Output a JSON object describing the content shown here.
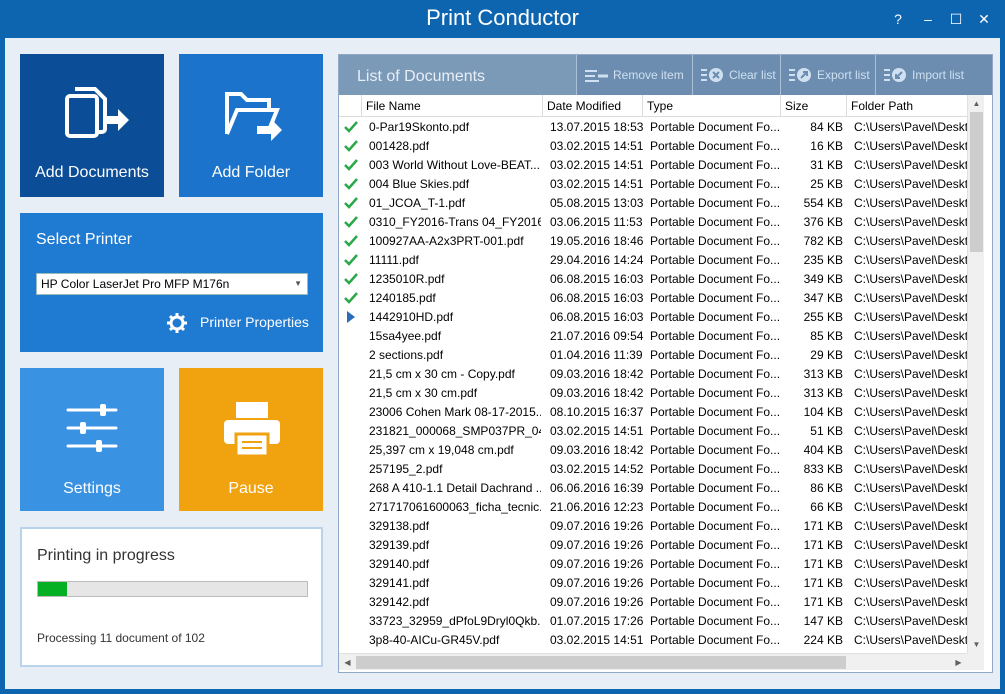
{
  "window": {
    "title": "Print Conductor",
    "help": "?",
    "minimize": "–",
    "maximize": "☐",
    "close": "✕"
  },
  "tiles": {
    "add_documents": "Add Documents",
    "add_folder": "Add Folder",
    "select_printer": "Select Printer",
    "printer_value": "HP Color LaserJet Pro MFP M176n",
    "printer_properties": "Printer Properties",
    "settings": "Settings",
    "pause": "Pause"
  },
  "progress": {
    "title": "Printing in progress",
    "status": "Processing 11 document of 102",
    "fraction": 0.108
  },
  "documents": {
    "title": "List of Documents",
    "toolbar": {
      "remove": "Remove item",
      "clear": "Clear list",
      "export": "Export list",
      "import": "Import list"
    },
    "columns": [
      "File Name",
      "Date Modified",
      "Type",
      "Size",
      "Folder Path"
    ],
    "rows": [
      {
        "status": "done",
        "name": "0-Par19Skonto.pdf",
        "date": "13.07.2015 18:53",
        "type": "Portable Document Fo...",
        "size": "84 KB",
        "path": "C:\\Users\\Pavel\\Deskt"
      },
      {
        "status": "done",
        "name": "001428.pdf",
        "date": "03.02.2015 14:51",
        "type": "Portable Document Fo...",
        "size": "16 KB",
        "path": "C:\\Users\\Pavel\\Deskt"
      },
      {
        "status": "done",
        "name": "003 World Without Love-BEAT...",
        "date": "03.02.2015 14:51",
        "type": "Portable Document Fo...",
        "size": "31 KB",
        "path": "C:\\Users\\Pavel\\Deskt"
      },
      {
        "status": "done",
        "name": "004 Blue Skies.pdf",
        "date": "03.02.2015 14:51",
        "type": "Portable Document Fo...",
        "size": "25 KB",
        "path": "C:\\Users\\Pavel\\Deskt"
      },
      {
        "status": "done",
        "name": "01_JCOA_T-1.pdf",
        "date": "05.08.2015 13:03",
        "type": "Portable Document Fo...",
        "size": "554 KB",
        "path": "C:\\Users\\Pavel\\Deskt"
      },
      {
        "status": "done",
        "name": "0310_FY2016-Trans 04_FY2016...",
        "date": "03.06.2015 11:53",
        "type": "Portable Document Fo...",
        "size": "376 KB",
        "path": "C:\\Users\\Pavel\\Deskt"
      },
      {
        "status": "done",
        "name": "100927AA-A2x3PRT-001.pdf",
        "date": "19.05.2016 18:46",
        "type": "Portable Document Fo...",
        "size": "782 KB",
        "path": "C:\\Users\\Pavel\\Deskt"
      },
      {
        "status": "done",
        "name": "11111.pdf",
        "date": "29.04.2016 14:24",
        "type": "Portable Document Fo...",
        "size": "235 KB",
        "path": "C:\\Users\\Pavel\\Deskt"
      },
      {
        "status": "done",
        "name": "1235010R.pdf",
        "date": "06.08.2015 16:03",
        "type": "Portable Document Fo...",
        "size": "349 KB",
        "path": "C:\\Users\\Pavel\\Deskt"
      },
      {
        "status": "done",
        "name": "1240185.pdf",
        "date": "06.08.2015 16:03",
        "type": "Portable Document Fo...",
        "size": "347 KB",
        "path": "C:\\Users\\Pavel\\Deskt"
      },
      {
        "status": "current",
        "name": "1442910HD.pdf",
        "date": "06.08.2015 16:03",
        "type": "Portable Document Fo...",
        "size": "255 KB",
        "path": "C:\\Users\\Pavel\\Deskt"
      },
      {
        "status": "",
        "name": "15sa4yee.pdf",
        "date": "21.07.2016 09:54",
        "type": "Portable Document Fo...",
        "size": "85 KB",
        "path": "C:\\Users\\Pavel\\Deskt"
      },
      {
        "status": "",
        "name": "2 sections.pdf",
        "date": "01.04.2016 11:39",
        "type": "Portable Document Fo...",
        "size": "29 KB",
        "path": "C:\\Users\\Pavel\\Deskt"
      },
      {
        "status": "",
        "name": "21,5 cm x 30 cm - Copy.pdf",
        "date": "09.03.2016 18:42",
        "type": "Portable Document Fo...",
        "size": "313 KB",
        "path": "C:\\Users\\Pavel\\Deskt"
      },
      {
        "status": "",
        "name": "21,5 cm x 30 cm.pdf",
        "date": "09.03.2016 18:42",
        "type": "Portable Document Fo...",
        "size": "313 KB",
        "path": "C:\\Users\\Pavel\\Deskt"
      },
      {
        "status": "",
        "name": "23006 Cohen Mark 08-17-2015...",
        "date": "08.10.2015 16:37",
        "type": "Portable Document Fo...",
        "size": "104 KB",
        "path": "C:\\Users\\Pavel\\Deskt"
      },
      {
        "status": "",
        "name": "231821_000068_SMP037PR_04...",
        "date": "03.02.2015 14:51",
        "type": "Portable Document Fo...",
        "size": "51 KB",
        "path": "C:\\Users\\Pavel\\Deskt"
      },
      {
        "status": "",
        "name": "25,397 cm x 19,048 cm.pdf",
        "date": "09.03.2016 18:42",
        "type": "Portable Document Fo...",
        "size": "404 KB",
        "path": "C:\\Users\\Pavel\\Deskt"
      },
      {
        "status": "",
        "name": "257195_2.pdf",
        "date": "03.02.2015 14:52",
        "type": "Portable Document Fo...",
        "size": "833 KB",
        "path": "C:\\Users\\Pavel\\Deskt"
      },
      {
        "status": "",
        "name": "268 A 410-1.1 Detail Dachrand ...",
        "date": "06.06.2016 16:39",
        "type": "Portable Document Fo...",
        "size": "86 KB",
        "path": "C:\\Users\\Pavel\\Deskt"
      },
      {
        "status": "",
        "name": "271717061600063_ficha_tecnic...",
        "date": "21.06.2016 12:23",
        "type": "Portable Document Fo...",
        "size": "66 KB",
        "path": "C:\\Users\\Pavel\\Deskt"
      },
      {
        "status": "",
        "name": "329138.pdf",
        "date": "09.07.2016 19:26",
        "type": "Portable Document Fo...",
        "size": "171 KB",
        "path": "C:\\Users\\Pavel\\Deskt"
      },
      {
        "status": "",
        "name": "329139.pdf",
        "date": "09.07.2016 19:26",
        "type": "Portable Document Fo...",
        "size": "171 KB",
        "path": "C:\\Users\\Pavel\\Deskt"
      },
      {
        "status": "",
        "name": "329140.pdf",
        "date": "09.07.2016 19:26",
        "type": "Portable Document Fo...",
        "size": "171 KB",
        "path": "C:\\Users\\Pavel\\Deskt"
      },
      {
        "status": "",
        "name": "329141.pdf",
        "date": "09.07.2016 19:26",
        "type": "Portable Document Fo...",
        "size": "171 KB",
        "path": "C:\\Users\\Pavel\\Deskt"
      },
      {
        "status": "",
        "name": "329142.pdf",
        "date": "09.07.2016 19:26",
        "type": "Portable Document Fo...",
        "size": "171 KB",
        "path": "C:\\Users\\Pavel\\Deskt"
      },
      {
        "status": "",
        "name": "33723_32959_dPfoL9Dryl0Qkb...",
        "date": "01.07.2015 17:26",
        "type": "Portable Document Fo...",
        "size": "147 KB",
        "path": "C:\\Users\\Pavel\\Deskt"
      },
      {
        "status": "",
        "name": "3p8-40-AICu-GR45V.pdf",
        "date": "03.02.2015 14:51",
        "type": "Portable Document Fo...",
        "size": "224 KB",
        "path": "C:\\Users\\Pavel\\Deskt"
      }
    ]
  },
  "colors": {
    "title_bar": "#0d65b0",
    "tile_dark": "#0b4d96",
    "tile_mid": "#1b73cc",
    "tile_light": "#3a92e3",
    "tile_orange": "#f1a20f",
    "check": "#2aa84a",
    "progress": "#06b025"
  }
}
